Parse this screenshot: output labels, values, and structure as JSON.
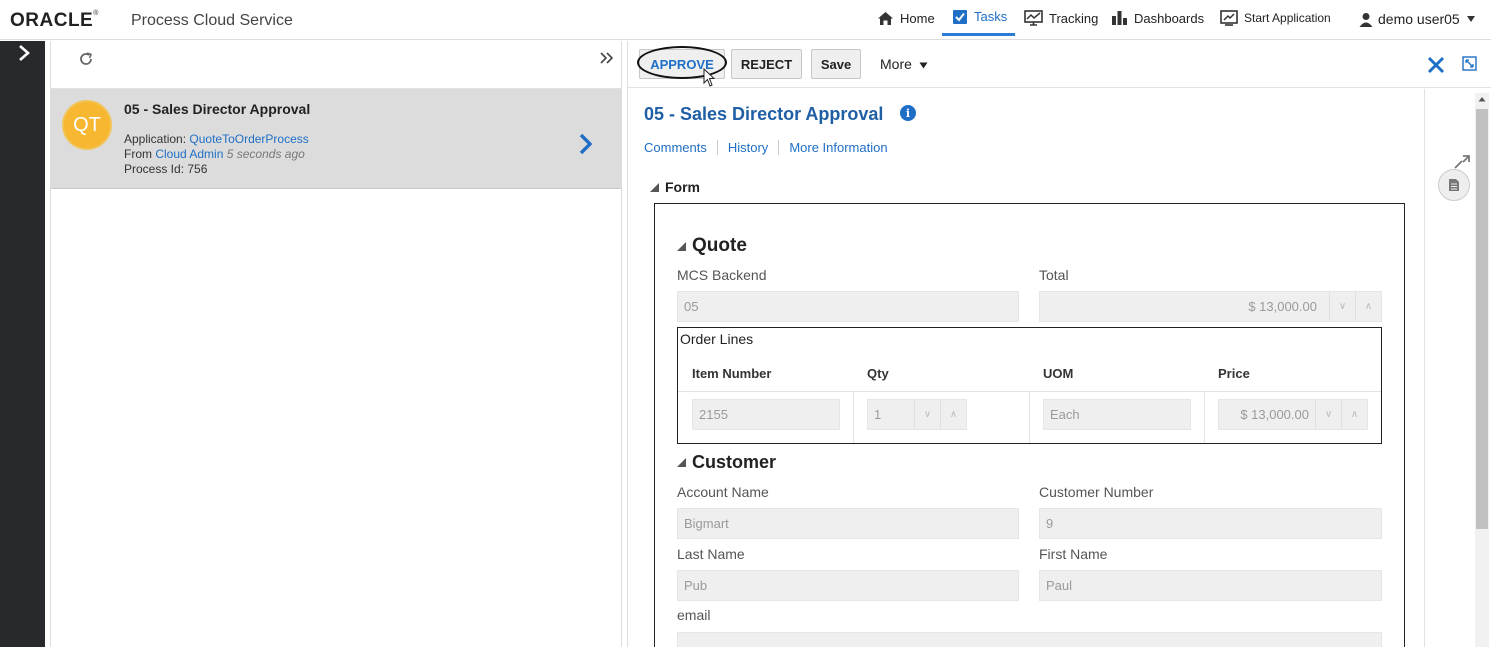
{
  "header": {
    "brand": "ORACLE",
    "product": "Process Cloud Service",
    "nav": [
      {
        "label": "Home",
        "icon": "home-icon"
      },
      {
        "label": "Tasks",
        "icon": "tasks-icon",
        "active": true
      },
      {
        "label": "Tracking",
        "icon": "tracking-icon"
      },
      {
        "label": "Dashboards",
        "icon": "dashboards-icon"
      },
      {
        "label": "Start Application",
        "icon": "start-application-icon"
      }
    ],
    "user": "demo user05"
  },
  "task_list": {
    "items": [
      {
        "initials": "QT",
        "title": "05 - Sales Director Approval",
        "application_label": "Application:",
        "application": "QuoteToOrderProcess",
        "from_label": "From",
        "from": "Cloud Admin",
        "time": "5 seconds ago",
        "process_id": "Process Id: 756"
      }
    ]
  },
  "detail": {
    "toolbar": {
      "approve": "APPROVE",
      "reject": "REJECT",
      "save": "Save",
      "more": "More"
    },
    "title": "05 - Sales Director Approval",
    "tabs": [
      "Comments",
      "History",
      "More Information"
    ],
    "form_section": "Form",
    "quote": {
      "heading": "Quote",
      "mcs_backend_label": "MCS Backend",
      "mcs_backend_value": "05",
      "total_label": "Total",
      "total_value": "$ 13,000.00",
      "order_lines": {
        "title": "Order Lines",
        "columns": [
          "Item Number",
          "Qty",
          "UOM",
          "Price"
        ],
        "rows": [
          {
            "item_number": "2155",
            "qty": "1",
            "uom": "Each",
            "price": "$ 13,000.00"
          }
        ]
      }
    },
    "customer": {
      "heading": "Customer",
      "account_name_label": "Account Name",
      "account_name_value": "Bigmart",
      "customer_number_label": "Customer Number",
      "customer_number_value": "9",
      "last_name_label": "Last Name",
      "last_name_value": "Pub",
      "first_name_label": "First Name",
      "first_name_value": "Paul",
      "email_label": "email",
      "email_value": ""
    }
  },
  "colors": {
    "accent": "#1f6fc6",
    "avatar": "#f7b731",
    "rail": "#27292d"
  }
}
